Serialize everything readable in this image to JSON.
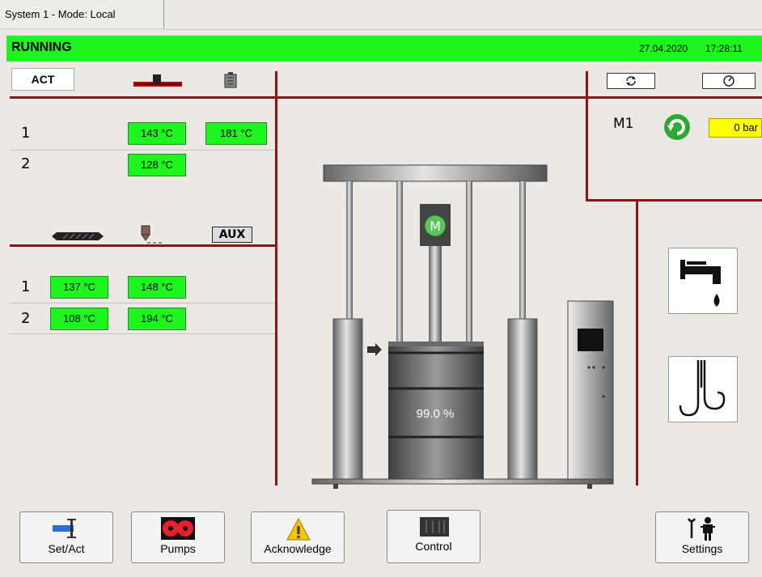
{
  "window": {
    "tab_title": "System 1 - Mode: Local"
  },
  "status": {
    "text": "RUNNING",
    "date": "27.04.2020",
    "time": "17:28:11",
    "color": "#1ef51e"
  },
  "panel_top": {
    "act_label": "ACT",
    "rows": [
      {
        "label": "1",
        "temps": [
          "143 °C",
          "181 °C"
        ]
      },
      {
        "label": "2",
        "temps": [
          "128 °C"
        ]
      }
    ]
  },
  "panel_bottom": {
    "aux_label": "AUX",
    "rows": [
      {
        "label": "1",
        "temps": [
          "137 °C",
          "148 °C"
        ]
      },
      {
        "label": "2",
        "temps": [
          "108 °C",
          "194 °C"
        ]
      }
    ]
  },
  "motor": {
    "name": "M1",
    "pressure": "0 bar",
    "badge": "M"
  },
  "drum": {
    "fill_level": "99.0 %"
  },
  "footer": {
    "set_act": "Set/Act",
    "pumps": "Pumps",
    "acknowledge": "Acknowledge",
    "control": "Control",
    "settings": "Settings"
  },
  "colors": {
    "accent_green": "#1ef51e",
    "frame_red": "#8b1414",
    "pressure_yellow": "#ffff00"
  },
  "icons": [
    "hose-icon",
    "tank-icon",
    "refresh-icon",
    "gauge-icon",
    "heater-icon",
    "nozzle-icon",
    "rotate-icon",
    "faucet-icon",
    "hooks-icon",
    "warning-icon",
    "pumps-icon",
    "control-icon",
    "settings-icon",
    "set-act-icon"
  ]
}
